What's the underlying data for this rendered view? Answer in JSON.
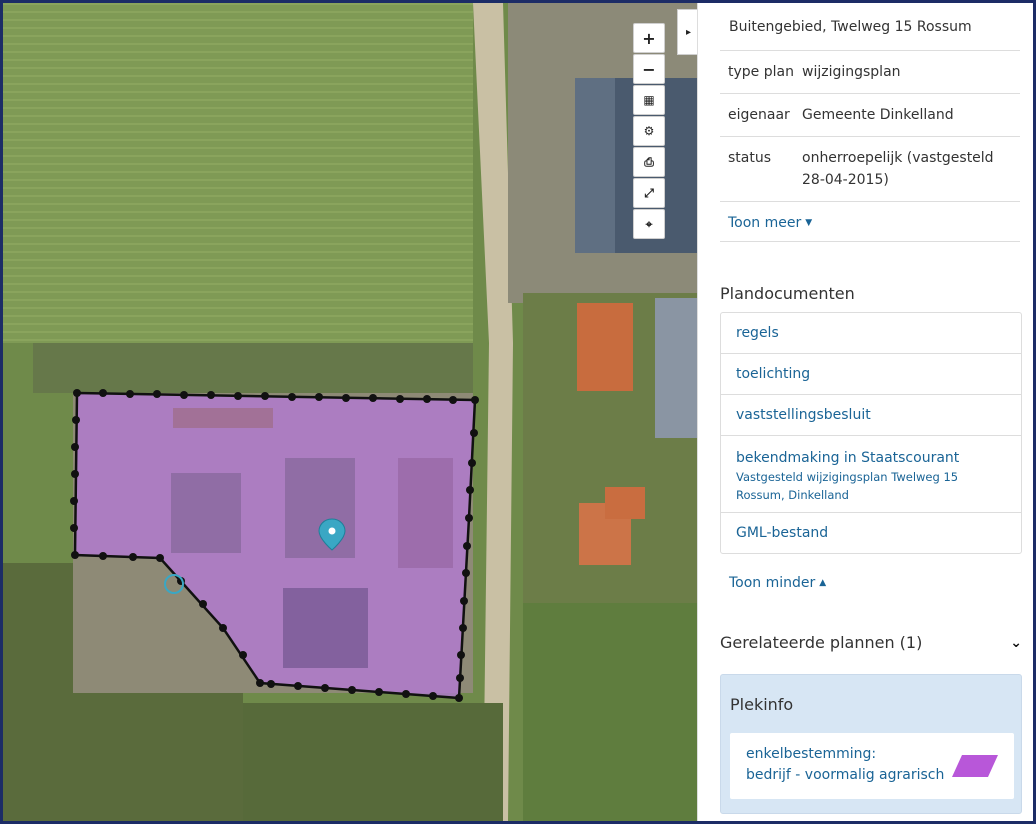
{
  "map": {
    "controls": [
      {
        "name": "zoom-in-button",
        "icon": "plus-icon",
        "glyph": "+"
      },
      {
        "name": "zoom-out-button",
        "icon": "minus-icon",
        "glyph": "−"
      },
      {
        "name": "layers-button",
        "icon": "layers-icon",
        "glyph": "▦"
      },
      {
        "name": "settings-button",
        "icon": "gear-icon",
        "glyph": "⚙"
      },
      {
        "name": "print-button",
        "icon": "printer-icon",
        "glyph": "⎙"
      },
      {
        "name": "fullscreen-button",
        "icon": "expand-icon",
        "glyph": "⤢"
      },
      {
        "name": "locate-button",
        "icon": "crosshair-icon",
        "glyph": "⌖"
      }
    ],
    "panel_toggle_glyph": "▸",
    "plan_area_color": "#b57ad6",
    "marker_color": "#3aa7c4"
  },
  "panel": {
    "plan_title": "Buitengebied, Twelweg 15 Rossum",
    "info": [
      {
        "key": "type plan",
        "value": "wijzigingsplan"
      },
      {
        "key": "eigenaar",
        "value": "Gemeente Dinkelland"
      },
      {
        "key": "status",
        "value": "onherroepelijk (vastgesteld 28-04-2015)"
      }
    ],
    "toon_meer": "Toon meer",
    "documents_heading": "Plandocumenten",
    "documents": [
      {
        "label": "regels"
      },
      {
        "label": "toelichting"
      },
      {
        "label": "vaststellingsbesluit"
      },
      {
        "label": "bekendmaking in Staatscourant",
        "sub": "Vastgesteld wijzigingsplan Twelweg 15 Rossum, Dinkelland"
      },
      {
        "label": "GML-bestand"
      }
    ],
    "toon_minder": "Toon minder",
    "related_heading": "Gerelateerde plannen (1)",
    "plekinfo": {
      "title": "Plekinfo",
      "line1": "enkelbestemming:",
      "line2": "bedrijf - voormalig agrarisch",
      "swatch_color": "#b857d9"
    }
  },
  "colors": {
    "link": "#1a6496",
    "frame_border": "#1c2c66",
    "plekinfo_bg": "#d7e6f4"
  }
}
